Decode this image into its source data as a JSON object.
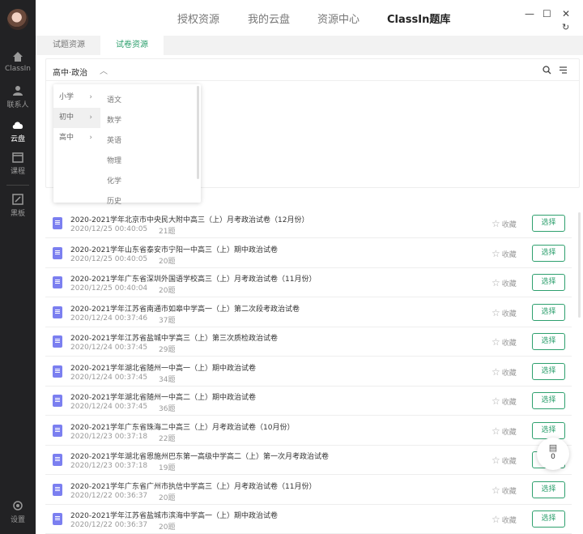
{
  "sidebar": {
    "items": [
      {
        "label": "ClassIn",
        "icon": "home-icon"
      },
      {
        "label": "联系人",
        "icon": "person-icon"
      },
      {
        "label": "云盘",
        "icon": "cloud-icon",
        "active": true
      },
      {
        "label": "课程",
        "icon": "calendar-icon"
      },
      {
        "label": "黑板",
        "icon": "blackboard-icon"
      },
      {
        "label": "设置",
        "icon": "settings-icon"
      }
    ]
  },
  "topbar": {
    "tabs": [
      {
        "label": "授权资源"
      },
      {
        "label": "我的云盘"
      },
      {
        "label": "资源中心"
      },
      {
        "label": "ClassIn题库",
        "active": true
      }
    ]
  },
  "subtabs": [
    {
      "label": "试题资源"
    },
    {
      "label": "试卷资源",
      "active": true
    }
  ],
  "filter": {
    "selected": "高中·政治"
  },
  "dropdown": {
    "levels": [
      "小学",
      "初中",
      "高中"
    ],
    "subjects": [
      "语文",
      "数学",
      "英语",
      "物理",
      "化学",
      "历史"
    ]
  },
  "list": {
    "favorite_label": "收藏",
    "select_label": "选择",
    "items": [
      {
        "title": "2020-2021学年北京市中央民大附中高三（上）月考政治试卷（12月份）",
        "date": "2020/12/25 00:40:05",
        "count": "21题"
      },
      {
        "title": "2020-2021学年山东省泰安市宁阳一中高三（上）期中政治试卷",
        "date": "2020/12/25 00:40:05",
        "count": "20题"
      },
      {
        "title": "2020-2021学年广东省深圳外国语学校高三（上）月考政治试卷（11月份）",
        "date": "2020/12/25 00:40:04",
        "count": "20题"
      },
      {
        "title": "2020-2021学年江苏省南通市如皋中学高一（上）第二次段考政治试卷",
        "date": "2020/12/24 00:37:46",
        "count": "37题"
      },
      {
        "title": "2020-2021学年江苏省盐城中学高三（上）第三次质检政治试卷",
        "date": "2020/12/24 00:37:45",
        "count": "29题"
      },
      {
        "title": "2020-2021学年湖北省随州一中高一（上）期中政治试卷",
        "date": "2020/12/24 00:37:45",
        "count": "34题"
      },
      {
        "title": "2020-2021学年湖北省随州一中高二（上）期中政治试卷",
        "date": "2020/12/24 00:37:45",
        "count": "36题"
      },
      {
        "title": "2020-2021学年广东省珠海二中高三（上）月考政治试卷（10月份）",
        "date": "2020/12/23 00:37:18",
        "count": "22题"
      },
      {
        "title": "2020-2021学年湖北省恩施州巴东第一高级中学高二（上）第一次月考政治试卷",
        "date": "2020/12/23 00:37:18",
        "count": "19题"
      },
      {
        "title": "2020-2021学年广东省广州市执信中学高三（上）月考政治试卷（11月份）",
        "date": "2020/12/22 00:36:37",
        "count": "20题"
      },
      {
        "title": "2020-2021学年江苏省盐城市滨海中学高一（上）期中政治试卷",
        "date": "2020/12/22 00:36:37",
        "count": "20题"
      }
    ]
  },
  "basket": {
    "count": "0"
  }
}
